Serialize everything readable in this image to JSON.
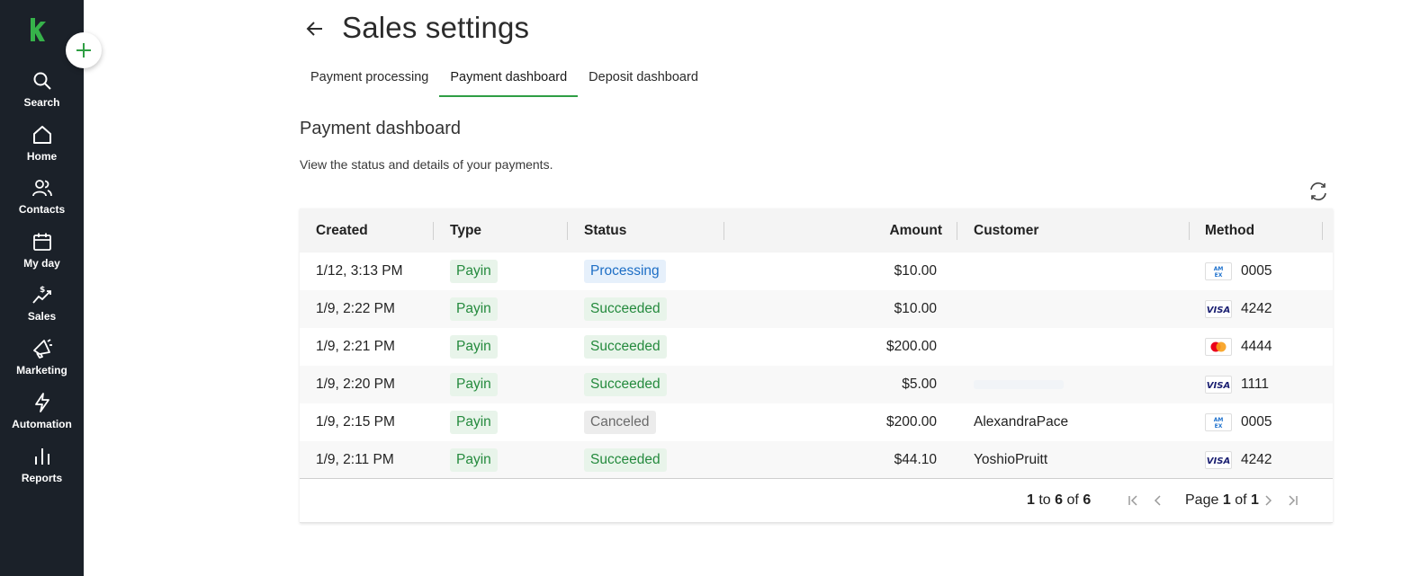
{
  "sidebar": {
    "items": [
      {
        "label": "Search",
        "icon": "search-icon"
      },
      {
        "label": "Home",
        "icon": "home-icon"
      },
      {
        "label": "Contacts",
        "icon": "contacts-icon"
      },
      {
        "label": "My day",
        "icon": "calendar-icon"
      },
      {
        "label": "Sales",
        "icon": "sales-icon"
      },
      {
        "label": "Marketing",
        "icon": "megaphone-icon"
      },
      {
        "label": "Automation",
        "icon": "lightning-icon"
      },
      {
        "label": "Reports",
        "icon": "bar-chart-icon"
      }
    ]
  },
  "header": {
    "title": "Sales settings"
  },
  "tabs": [
    {
      "label": "Payment processing",
      "active": false
    },
    {
      "label": "Payment dashboard",
      "active": true
    },
    {
      "label": "Deposit dashboard",
      "active": false
    }
  ],
  "section": {
    "title": "Payment dashboard",
    "description": "View the status and details of your payments."
  },
  "table": {
    "columns": {
      "created": "Created",
      "type": "Type",
      "status": "Status",
      "amount": "Amount",
      "customer": "Customer",
      "method": "Method"
    },
    "rows": [
      {
        "created": "1/12, 3:13 PM",
        "type": "Payin",
        "status": "Processing",
        "amount": "$10.00",
        "customer": "",
        "card": "amex",
        "last4": "0005"
      },
      {
        "created": "1/9, 2:22 PM",
        "type": "Payin",
        "status": "Succeeded",
        "amount": "$10.00",
        "customer": "",
        "card": "visa",
        "last4": "4242"
      },
      {
        "created": "1/9, 2:21 PM",
        "type": "Payin",
        "status": "Succeeded",
        "amount": "$200.00",
        "customer": "",
        "card": "mastercard",
        "last4": "4444"
      },
      {
        "created": "1/9, 2:20 PM",
        "type": "Payin",
        "status": "Succeeded",
        "amount": "$5.00",
        "customer": "",
        "card": "visa",
        "last4": "1111"
      },
      {
        "created": "1/9, 2:15 PM",
        "type": "Payin",
        "status": "Canceled",
        "amount": "$200.00",
        "customer": "AlexandraPace",
        "card": "amex",
        "last4": "0005"
      },
      {
        "created": "1/9, 2:11 PM",
        "type": "Payin",
        "status": "Succeeded",
        "amount": "$44.10",
        "customer": "YoshioPruitt",
        "card": "visa",
        "last4": "4242"
      }
    ]
  },
  "footer": {
    "range_start": "1",
    "range_to": "to",
    "range_end": "6",
    "range_of": "of",
    "total": "6",
    "page_word": "Page",
    "page_current": "1",
    "page_of": "of",
    "page_total": "1"
  },
  "colors": {
    "sidebar_bg": "#1b2129",
    "brand_green": "#2f9e44",
    "succeeded": "#248a3d",
    "processing": "#1d6ec5",
    "canceled": "#6a6a6a"
  }
}
